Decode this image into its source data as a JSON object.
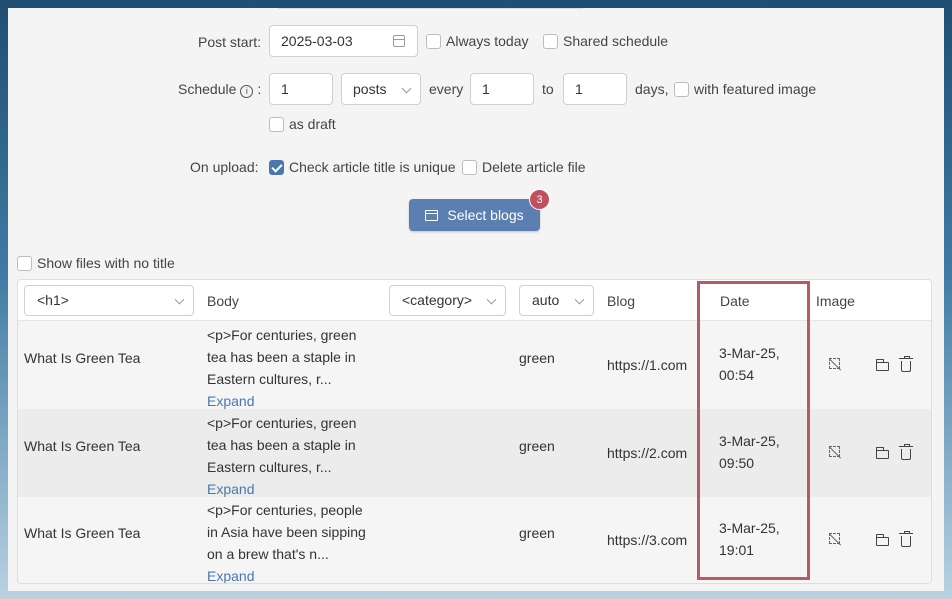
{
  "form": {
    "post_start_label": "Post start",
    "post_start_value": "2025-03-03",
    "always_today": "Always today",
    "shared_schedule": "Shared schedule",
    "schedule_label": "Schedule",
    "schedule_info": "i",
    "colon": ":",
    "schedule_count": "1",
    "schedule_unit": "posts",
    "every_label": "every",
    "every_from": "1",
    "to_label": "to",
    "every_to": "1",
    "days_label": "days,",
    "with_featured_image": "with featured image",
    "as_draft": "as draft",
    "on_upload_label": "On upload",
    "check_title_unique": "Check article title is unique",
    "delete_article_file": "Delete article file",
    "select_blogs": "Select blogs",
    "select_blogs_badge": "3",
    "show_files_no_title": "Show files with no title"
  },
  "table": {
    "headers": {
      "title_select": "<h1>",
      "body": "Body",
      "category_select": "<category>",
      "auto_select": "auto",
      "blog": "Blog",
      "date": "Date",
      "image": "Image"
    },
    "rows": [
      {
        "title": "What Is Green Tea",
        "body_l1": "<p>For centuries, green",
        "body_l2": "tea has been a staple in",
        "body_l3": "Eastern cultures, r...",
        "expand": "Expand",
        "category": "green",
        "blog": "https://1.com",
        "date_l1": "3-Mar-25,",
        "date_l2": "00:54"
      },
      {
        "title": "What Is Green Tea",
        "body_l1": "<p>For centuries, green",
        "body_l2": "tea has been a staple in",
        "body_l3": "Eastern cultures, r...",
        "expand": "Expand",
        "category": "green",
        "blog": "https://2.com",
        "date_l1": "3-Mar-25,",
        "date_l2": "09:50"
      },
      {
        "title": "What Is Green Tea",
        "body_l1": "<p>For centuries, people",
        "body_l2": "in Asia have been sipping",
        "body_l3": "on a brew that's n...",
        "expand": "Expand",
        "category": "green",
        "blog": "https://3.com",
        "date_l1": "3-Mar-25,",
        "date_l2": "19:01"
      }
    ]
  },
  "colors": {
    "accent": "#5b7fb0",
    "badge": "#c0505e",
    "highlight": "#b75a66"
  }
}
